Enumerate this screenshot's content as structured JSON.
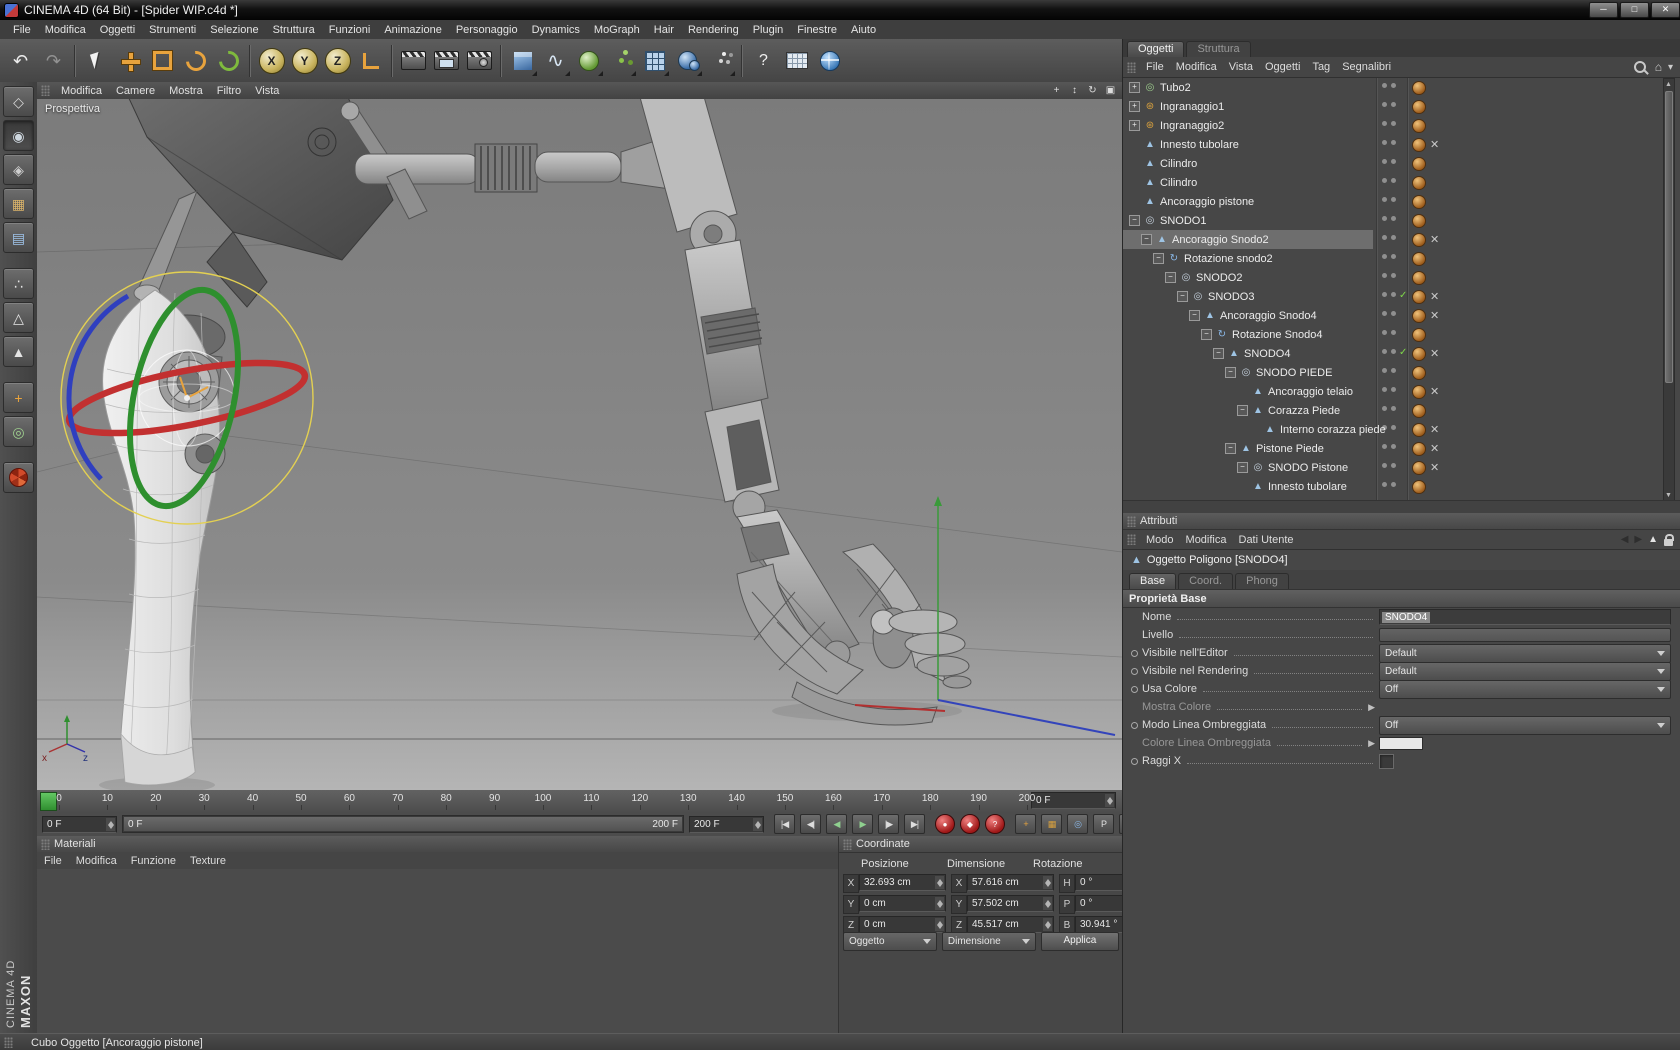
{
  "window": {
    "title": "CINEMA 4D (64 Bit) - [Spider WIP.c4d *]",
    "controls": [
      {
        "name": "minimize-icon",
        "glyph": "─"
      },
      {
        "name": "maximize-icon",
        "glyph": "□"
      },
      {
        "name": "close-icon",
        "glyph": "✕"
      }
    ],
    "status_text": "Cubo Oggetto [Ancoraggio pistone]",
    "brand_line1": "MAXON",
    "brand_line2": "CINEMA 4D"
  },
  "menubar": {
    "items": [
      "File",
      "Modifica",
      "Oggetti",
      "Strumenti",
      "Selezione",
      "Struttura",
      "Funzioni",
      "Animazione",
      "Personaggio",
      "Dynamics",
      "MoGraph",
      "Hair",
      "Rendering",
      "Plugin",
      "Finestre",
      "Aiuto"
    ]
  },
  "toolbar": {
    "groups": [
      [
        {
          "name": "undo-button",
          "glyph": "↶",
          "color": "#ececec",
          "size": 18
        },
        {
          "name": "redo-button",
          "glyph": "↷",
          "color": "#929292",
          "size": 18
        }
      ],
      [
        {
          "name": "live-selection-button",
          "shape": "cursor"
        },
        {
          "name": "move-tool-button",
          "shape": "plus"
        },
        {
          "name": "scale-tool-button",
          "shape": "scale"
        },
        {
          "name": "rotate-tool-button",
          "shape": "rot"
        },
        {
          "name": "last-tool-button",
          "shape": "rot-green"
        }
      ],
      [
        {
          "name": "lock-x-button",
          "shape": "xyz",
          "letter": "X"
        },
        {
          "name": "lock-y-button",
          "shape": "xyz",
          "letter": "Y"
        },
        {
          "name": "lock-z-button",
          "shape": "xyz",
          "letter": "Z"
        },
        {
          "name": "coordinate-system-button",
          "shape": "axes"
        }
      ],
      [
        {
          "name": "render-view-button",
          "shape": "clapper"
        },
        {
          "name": "render-picture-viewer-button",
          "shape": "clapper-pv"
        },
        {
          "name": "render-settings-button",
          "shape": "clapper-set"
        }
      ],
      [
        {
          "name": "add-cube-button",
          "shape": "cube",
          "fly": true
        },
        {
          "name": "add-spline-button",
          "glyph": "∿",
          "color": "#d8e6f4",
          "size": 20,
          "fly": true
        },
        {
          "name": "add-subdivision-button",
          "shape": "sphere-g",
          "fly": true
        },
        {
          "name": "add-array-button",
          "shape": "atoms",
          "fly": true
        },
        {
          "name": "add-boole-button",
          "shape": "grid",
          "fly": true
        },
        {
          "name": "add-metaball-button",
          "shape": "sphere-b",
          "fly": true
        },
        {
          "name": "add-particles-button",
          "shape": "dots",
          "fly": true
        }
      ],
      [
        {
          "name": "help-button",
          "glyph": "?",
          "color": "#f0f0f0",
          "size": 16
        },
        {
          "name": "spreadsheet-button",
          "shape": "table"
        },
        {
          "name": "online-updater-button",
          "shape": "globe"
        }
      ]
    ]
  },
  "leftbar": {
    "items": [
      {
        "name": "make-editable-button",
        "glyph": "◇",
        "color": "#d8d8d8"
      },
      {
        "name": "model-mode-button",
        "glyph": "◉",
        "color": "#cfd8e0",
        "pressed": true
      },
      {
        "name": "texture-axis-mode-button",
        "glyph": "◈",
        "color": "#cfcfcf"
      },
      {
        "name": "texture-mode-button",
        "glyph": "▦",
        "color": "#d9b36a"
      },
      {
        "name": "workplane-mode-button",
        "glyph": "▤",
        "color": "#9fc4ea"
      },
      {
        "name": "gap1",
        "gap": true
      },
      {
        "name": "points-mode-button",
        "glyph": "∴",
        "color": "#e4e4e4"
      },
      {
        "name": "edges-mode-button",
        "glyph": "△",
        "color": "#e4e4e4"
      },
      {
        "name": "polygons-mode-button",
        "glyph": "▲",
        "color": "#e4e4e4"
      },
      {
        "name": "gap2",
        "gap": true
      },
      {
        "name": "enable-axis-button",
        "glyph": "+",
        "color": "#e8a33d"
      },
      {
        "name": "snap-button",
        "glyph": "◎",
        "color": "#9fd08f"
      },
      {
        "name": "gap3",
        "gap": true
      },
      {
        "name": "content-browser-button",
        "shape": "fan"
      }
    ]
  },
  "viewport": {
    "menu": [
      "Modifica",
      "Camere",
      "Mostra",
      "Filtro",
      "Vista"
    ],
    "header_icons": [
      {
        "name": "pan-view-icon",
        "glyph": "+"
      },
      {
        "name": "zoom-view-icon",
        "glyph": "↕"
      },
      {
        "name": "rotate-view-icon",
        "glyph": "↻"
      },
      {
        "name": "toggle-view-icon",
        "glyph": "▣"
      }
    ],
    "camera_label": "Prospettiva",
    "axis_x_label": "x",
    "axis_z_label": "z",
    "gizmo": {
      "yellow": "#e3d052",
      "red": "#c23030",
      "green": "#2e8f2e",
      "blue": "#2f3fbf"
    },
    "axes": {
      "x": "#b33030",
      "y": "#3a9a3a",
      "z": "#3344bb"
    }
  },
  "timeline": {
    "ticks": [
      "0",
      "10",
      "20",
      "30",
      "40",
      "50",
      "60",
      "70",
      "80",
      "90",
      "100",
      "110",
      "120",
      "130",
      "140",
      "150",
      "160",
      "170",
      "180",
      "190",
      "200"
    ],
    "frame_field": "0 F",
    "range_start_field": "0 F",
    "range_bar_left": "0 F",
    "range_bar_right": "200 F",
    "range_end_field": "200 F",
    "transport": [
      {
        "name": "goto-start-button",
        "glyph": "|◀",
        "color": "#dddddd"
      },
      {
        "name": "prev-key-button",
        "glyph": "◀|",
        "color": "#dddddd"
      },
      {
        "name": "prev-frame-button",
        "glyph": "◀",
        "color": "#8fd08f"
      },
      {
        "name": "play-button",
        "glyph": "▶",
        "color": "#8fd08f"
      },
      {
        "name": "next-key-button",
        "glyph": "|▶",
        "color": "#dddddd"
      },
      {
        "name": "goto-end-button",
        "glyph": "▶|",
        "color": "#dddddd"
      }
    ],
    "record": [
      {
        "name": "record-keyframe-button",
        "glyph": "●"
      },
      {
        "name": "autokey-button",
        "glyph": "◆"
      },
      {
        "name": "record-options-button",
        "glyph": "?"
      }
    ],
    "extra": [
      {
        "name": "keyframe-selection-button",
        "glyph": "+",
        "color": "#e8a33d"
      },
      {
        "name": "key-region-button",
        "glyph": "▦",
        "color": "#d9a13e"
      },
      {
        "name": "solo-button",
        "glyph": "◎",
        "color": "#8ab8e8"
      },
      {
        "name": "parameter-button",
        "glyph": "P",
        "color": "#e0e0e0"
      },
      {
        "name": "snapshot-button",
        "glyph": "▤",
        "color": "#e0e0e0"
      }
    ]
  },
  "materials": {
    "title": "Materiali",
    "menu": [
      "File",
      "Modifica",
      "Funzione",
      "Texture"
    ]
  },
  "coordinates": {
    "title": "Coordinate",
    "columns": [
      "Posizione",
      "Dimensione",
      "Rotazione"
    ],
    "rows": [
      {
        "cells": [
          [
            "X",
            "32.693 cm"
          ],
          [
            "X",
            "57.616 cm"
          ],
          [
            "H",
            "0 °"
          ]
        ]
      },
      {
        "cells": [
          [
            "Y",
            "0 cm"
          ],
          [
            "Y",
            "57.502 cm"
          ],
          [
            "P",
            "0 °"
          ]
        ]
      },
      {
        "cells": [
          [
            "Z",
            "0 cm"
          ],
          [
            "Z",
            "45.517 cm"
          ],
          [
            "B",
            "30.941 °"
          ]
        ]
      }
    ],
    "dropdown1": "Oggetto",
    "dropdown2": "Dimensione",
    "apply_label": "Applica"
  },
  "object_manager": {
    "tabs": [
      {
        "label": "Oggetti",
        "active": true
      },
      {
        "label": "Struttura",
        "active": false
      }
    ],
    "menu": [
      "File",
      "Modifica",
      "Vista",
      "Oggetti",
      "Tag",
      "Segnalibri"
    ],
    "tree": [
      {
        "label": "Tubo2",
        "indent": 0,
        "toggle": "+",
        "icon": "tube",
        "tags": [
          "t"
        ]
      },
      {
        "label": "Ingranaggio1",
        "indent": 0,
        "toggle": "+",
        "icon": "gear",
        "tags": [
          "t"
        ]
      },
      {
        "label": "Ingranaggio2",
        "indent": 0,
        "toggle": "+",
        "icon": "gear",
        "tags": [
          "t"
        ]
      },
      {
        "label": "Innesto tubolare",
        "indent": 0,
        "icon": "poly",
        "tags": [
          "t",
          "x"
        ]
      },
      {
        "label": "Cilindro",
        "indent": 0,
        "icon": "poly",
        "tags": [
          "t"
        ]
      },
      {
        "label": "Cilindro",
        "indent": 0,
        "icon": "poly",
        "tags": [
          "t"
        ]
      },
      {
        "label": "Ancoraggio pistone",
        "indent": 0,
        "icon": "poly",
        "tags": [
          "t"
        ]
      },
      {
        "label": "SNODO1",
        "indent": 0,
        "toggle": "-",
        "icon": "null",
        "tags": [
          "t"
        ]
      },
      {
        "label": "Ancoraggio Snodo2",
        "indent": 1,
        "toggle": "-",
        "icon": "poly",
        "selected": true,
        "tags": [
          "t",
          "x"
        ]
      },
      {
        "label": "Rotazione snodo2",
        "indent": 2,
        "toggle": "-",
        "icon": "rot",
        "tags": [
          "t"
        ]
      },
      {
        "label": "SNODO2",
        "indent": 3,
        "toggle": "-",
        "icon": "null",
        "tags": [
          "t"
        ]
      },
      {
        "label": "SNODO3",
        "indent": 4,
        "toggle": "-",
        "icon": "null",
        "check": true,
        "tags": [
          "t",
          "x"
        ]
      },
      {
        "label": "Ancoraggio Snodo4",
        "indent": 5,
        "toggle": "-",
        "icon": "poly",
        "tags": [
          "t",
          "x"
        ]
      },
      {
        "label": "Rotazione Snodo4",
        "indent": 6,
        "toggle": "-",
        "icon": "rot",
        "tags": [
          "t"
        ]
      },
      {
        "label": "SNODO4",
        "indent": 7,
        "toggle": "-",
        "icon": "poly",
        "check": true,
        "tags": [
          "t",
          "x"
        ]
      },
      {
        "label": "SNODO PIEDE",
        "indent": 8,
        "toggle": "-",
        "icon": "null",
        "tags": [
          "t"
        ]
      },
      {
        "label": "Ancoraggio telaio",
        "indent": 9,
        "icon": "poly",
        "tags": [
          "t",
          "x"
        ]
      },
      {
        "label": "Corazza Piede",
        "indent": 9,
        "toggle": "-",
        "icon": "poly",
        "tags": [
          "t"
        ]
      },
      {
        "label": "Interno corazza piede",
        "indent": 10,
        "icon": "poly",
        "tags": [
          "t",
          "x"
        ]
      },
      {
        "label": "Pistone Piede",
        "indent": 8,
        "toggle": "-",
        "icon": "poly",
        "tags": [
          "t",
          "x"
        ]
      },
      {
        "label": "SNODO Pistone",
        "indent": 9,
        "toggle": "-",
        "icon": "null",
        "tags": [
          "t",
          "x"
        ]
      },
      {
        "label": "Innesto tubolare",
        "indent": 9,
        "icon": "poly",
        "tags": [
          "t"
        ]
      }
    ]
  },
  "attributes": {
    "title": "Attributi",
    "menu": [
      "Modo",
      "Modifica",
      "Dati Utente"
    ],
    "object_header": "Oggetto Poligono [SNODO4]",
    "tabs": [
      {
        "label": "Base",
        "active": true
      },
      {
        "label": "Coord.",
        "active": false
      },
      {
        "label": "Phong",
        "active": false
      }
    ],
    "section": "Proprietà Base",
    "rows": [
      {
        "label": "Nome",
        "type": "text",
        "value": "SNODO4"
      },
      {
        "label": "Livello",
        "type": "level"
      },
      {
        "label": "Visibile nell'Editor",
        "type": "dropdown",
        "value": "Default",
        "dot": true
      },
      {
        "label": "Visibile nel Rendering",
        "type": "dropdown",
        "value": "Default",
        "dot": true
      },
      {
        "label": "Usa Colore",
        "type": "dropdown",
        "value": "Off",
        "dot": true
      },
      {
        "label": "Mostra Colore",
        "type": "flyout",
        "disabled": true
      },
      {
        "label": "Modo Linea Ombreggiata",
        "type": "dropdown",
        "value": "Off",
        "dot": true
      },
      {
        "label": "Colore Linea Ombreggiata",
        "type": "flyout",
        "disabled": true,
        "swatch": "#e8e8e8"
      },
      {
        "label": "Raggi X",
        "type": "checkbox",
        "dot": true
      }
    ]
  }
}
